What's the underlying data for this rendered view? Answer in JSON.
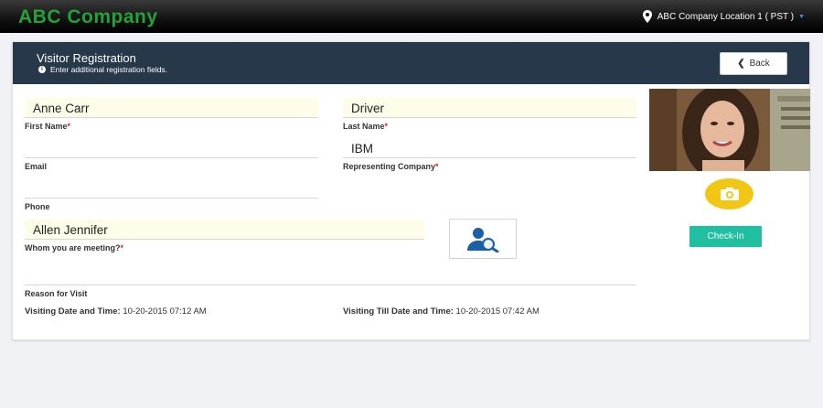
{
  "header": {
    "brand": "ABC Company",
    "brand_color": "#22a33a",
    "location": "ABC Company Location 1 ( PST )"
  },
  "panel": {
    "title": "Visitor Registration",
    "subtitle": "Enter additional registration fields.",
    "back_label": "Back"
  },
  "form": {
    "first_name": {
      "value": "Anne Carr",
      "label": "First Name"
    },
    "last_name": {
      "value": "Driver",
      "label": "Last Name"
    },
    "email": {
      "value": "",
      "label": "Email"
    },
    "company": {
      "value": "IBM",
      "label": "Representing Company"
    },
    "phone": {
      "value": "",
      "label": "Phone"
    },
    "meeting": {
      "value": "Allen Jennifer",
      "label": "Whom you are meeting?"
    },
    "reason": {
      "value": "",
      "label": "Reason for Visit"
    },
    "required_mark": "*"
  },
  "visit": {
    "from_label": "Visiting Date and Time:",
    "from_value": "10-20-2015 07:12 AM",
    "till_label": "Visiting Till Date and Time:",
    "till_value": "10-20-2015 07:42 AM"
  },
  "actions": {
    "checkin_label": "Check-In"
  },
  "colors": {
    "header_bg": "#26384a",
    "accent_yellow": "#f2c614",
    "checkin_green": "#1fbfa0"
  }
}
